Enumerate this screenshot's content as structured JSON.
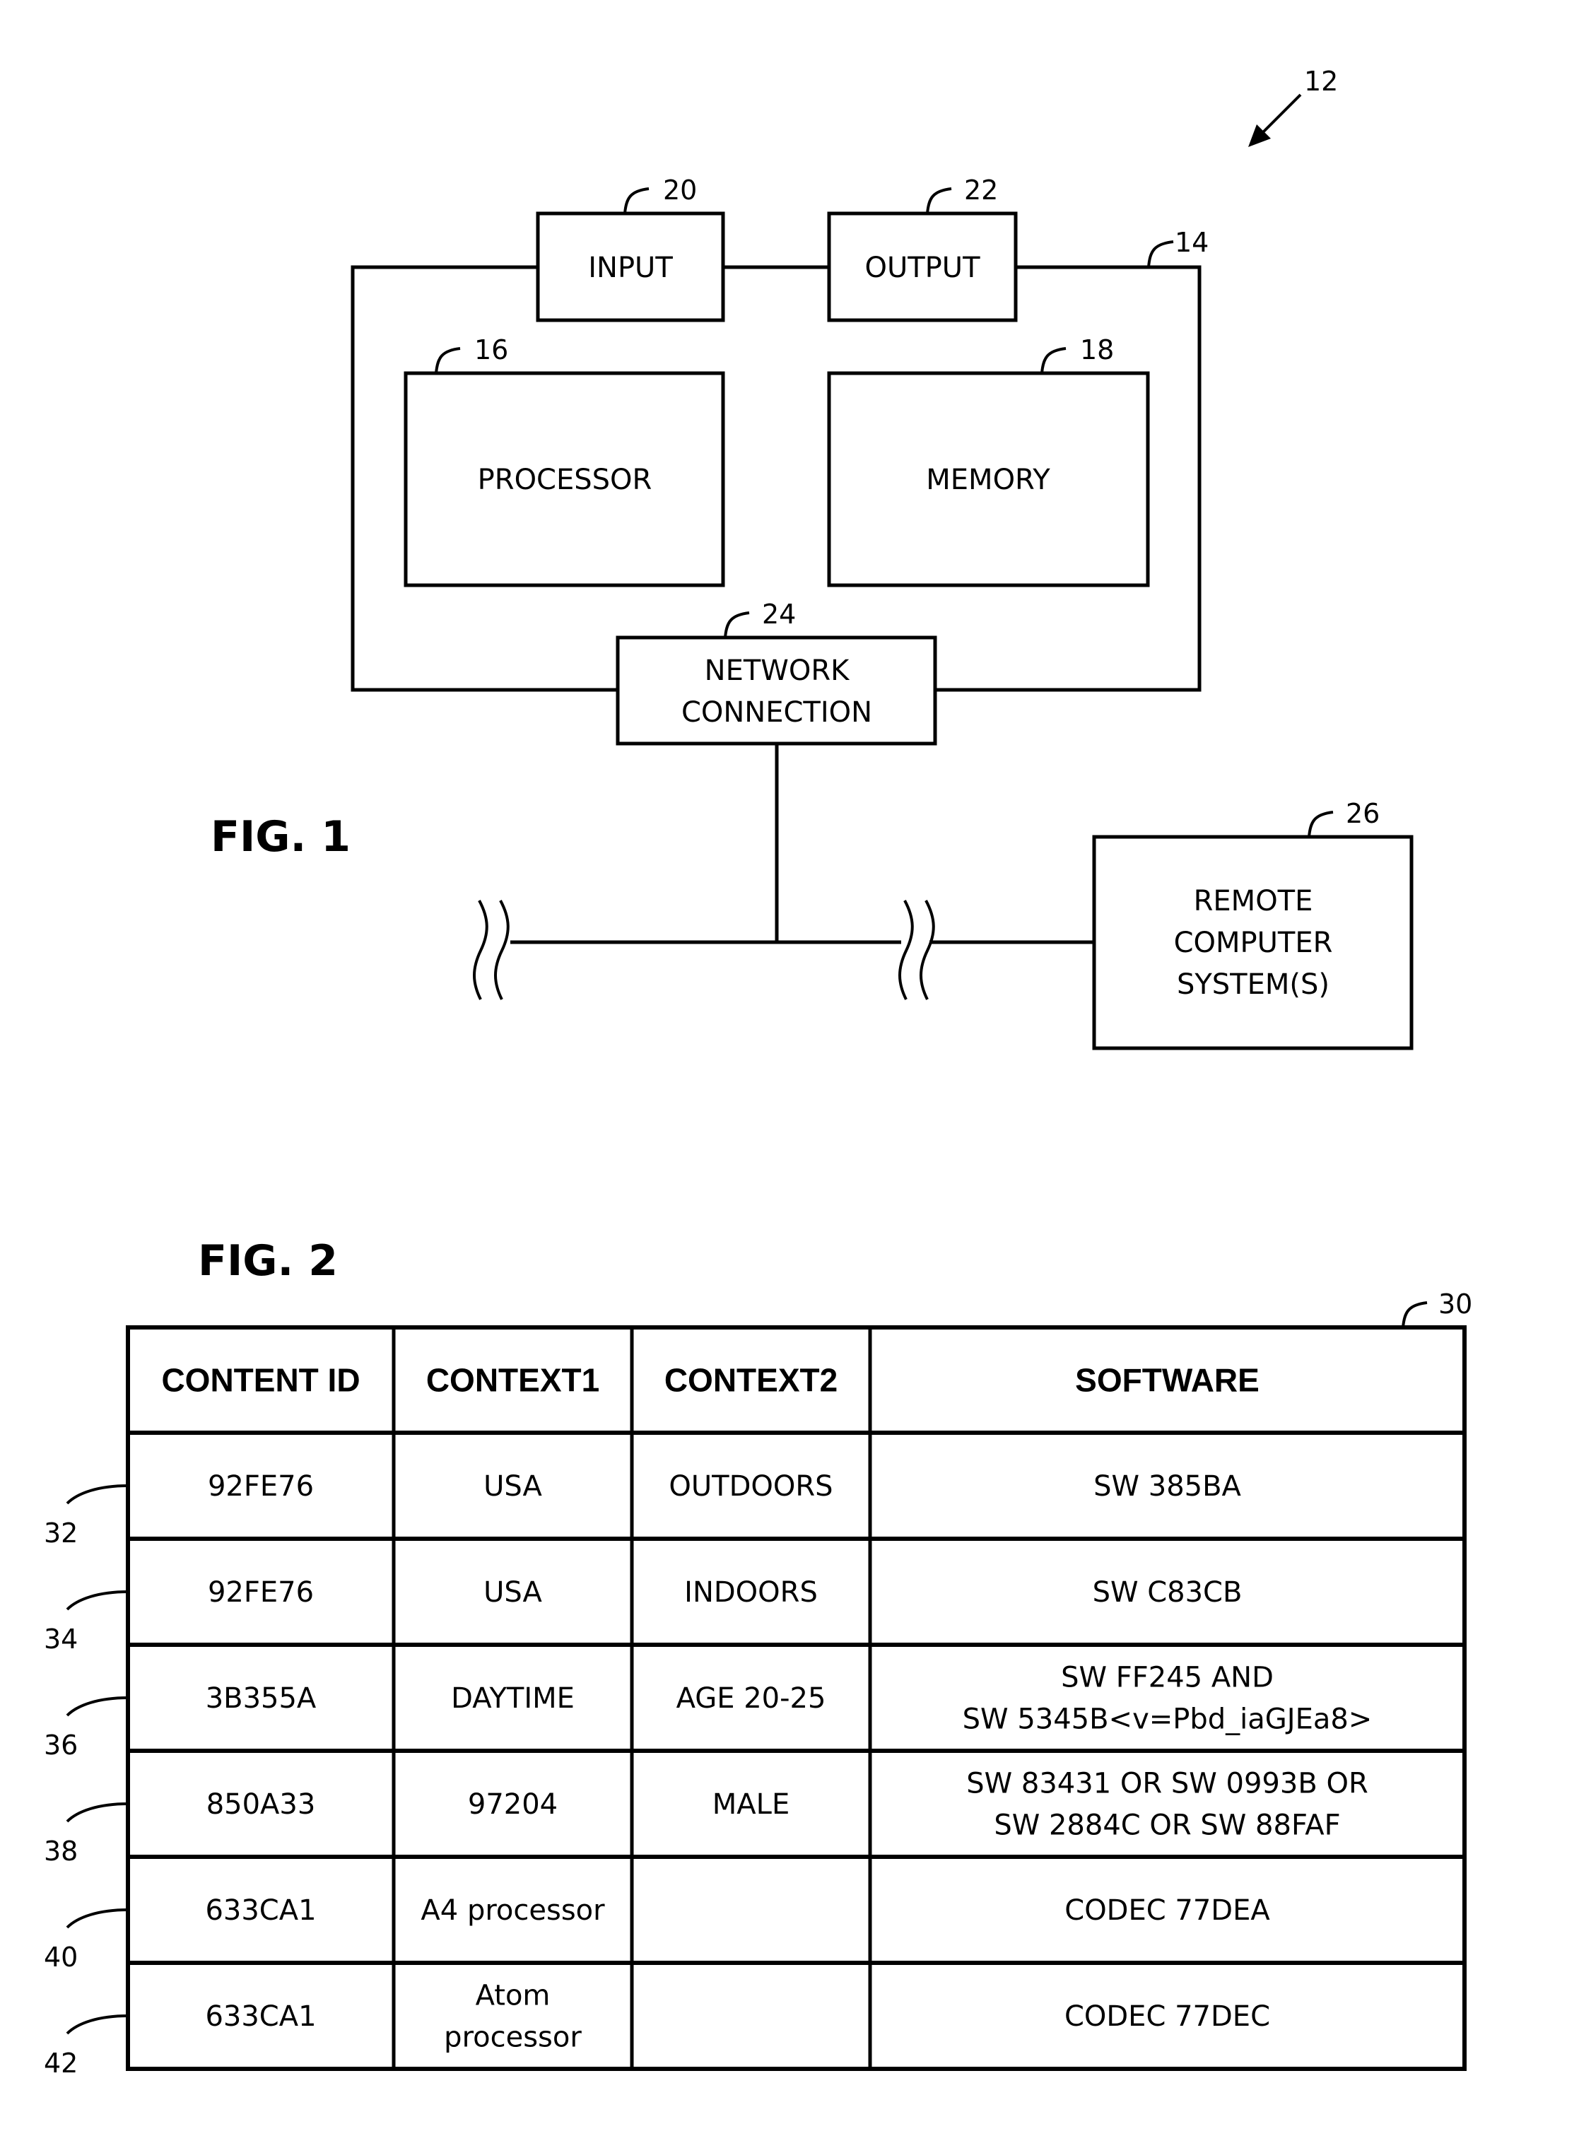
{
  "fig1": {
    "title": "FIG. 1",
    "system_ref": "12",
    "device_ref": "14",
    "input": {
      "ref": "20",
      "label": "INPUT"
    },
    "output": {
      "ref": "22",
      "label": "OUTPUT"
    },
    "processor": {
      "ref": "16",
      "label": "PROCESSOR"
    },
    "memory": {
      "ref": "18",
      "label": "MEMORY"
    },
    "network": {
      "ref": "24",
      "lines": [
        "NETWORK",
        "CONNECTION"
      ]
    },
    "remote": {
      "ref": "26",
      "lines": [
        "REMOTE",
        "COMPUTER",
        "SYSTEM(S)"
      ]
    }
  },
  "fig2": {
    "title": "FIG. 2",
    "table_ref": "30",
    "headers": [
      "CONTENT ID",
      "CONTEXT1",
      "CONTEXT2",
      "SOFTWARE"
    ],
    "rows": [
      {
        "ref": "32",
        "cells": [
          [
            "92FE76"
          ],
          [
            "USA"
          ],
          [
            "OUTDOORS"
          ],
          [
            "SW 385BA"
          ]
        ]
      },
      {
        "ref": "34",
        "cells": [
          [
            "92FE76"
          ],
          [
            "USA"
          ],
          [
            "INDOORS"
          ],
          [
            "SW C83CB"
          ]
        ]
      },
      {
        "ref": "36",
        "cells": [
          [
            "3B355A"
          ],
          [
            "DAYTIME"
          ],
          [
            "AGE 20-25"
          ],
          [
            "SW FF245 AND",
            "SW 5345B<v=Pbd_iaGJEa8>"
          ]
        ]
      },
      {
        "ref": "38",
        "cells": [
          [
            "850A33"
          ],
          [
            "97204"
          ],
          [
            "MALE"
          ],
          [
            "SW 83431 OR SW 0993B OR",
            "SW 2884C OR SW 88FAF"
          ]
        ]
      },
      {
        "ref": "40",
        "cells": [
          [
            "633CA1"
          ],
          [
            "A4 processor"
          ],
          [],
          [
            "CODEC 77DEA"
          ]
        ]
      },
      {
        "ref": "42",
        "cells": [
          [
            "633CA1"
          ],
          [
            "Atom",
            "processor"
          ],
          [],
          [
            "CODEC 77DEC"
          ]
        ]
      }
    ]
  }
}
